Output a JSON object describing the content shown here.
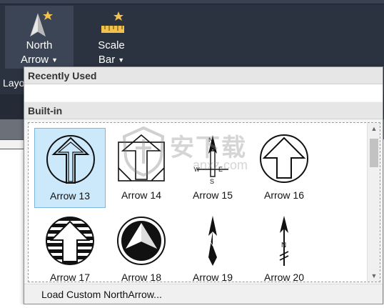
{
  "ribbon": {
    "north_arrow": {
      "label_line1": "North",
      "label_line2": "Arrow"
    },
    "scale_bar": {
      "label_line1": "Scale",
      "label_line2": "Bar"
    },
    "side_label": "Layo"
  },
  "dropdown": {
    "recently_used_header": "Recently Used",
    "built_in_header": "Built-in",
    "items": [
      {
        "label": "Arrow 13",
        "selected": true
      },
      {
        "label": "Arrow 14",
        "selected": false
      },
      {
        "label": "Arrow 15",
        "selected": false
      },
      {
        "label": "Arrow 16",
        "selected": false
      },
      {
        "label": "Arrow 17",
        "selected": false
      },
      {
        "label": "Arrow 18",
        "selected": false
      },
      {
        "label": "Arrow 19",
        "selected": false
      },
      {
        "label": "Arrow 20",
        "selected": false
      }
    ],
    "load_custom_label": "Load Custom NorthArrow..."
  },
  "watermark": {
    "text": "安下载",
    "sub": "anxz.com"
  },
  "colors": {
    "ribbon_bg": "#2b3240",
    "selected_bg": "#cce8fb",
    "selected_border": "#7ab8e0",
    "icon_gold": "#f2c14e"
  }
}
